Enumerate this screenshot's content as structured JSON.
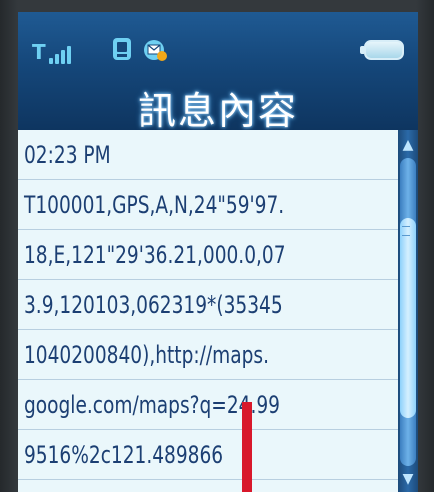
{
  "status_bar": {
    "signal_letter": "T",
    "signal_bars": [
      6,
      10,
      14,
      18
    ],
    "icons": [
      "phone-storage-icon",
      "new-message-icon"
    ],
    "battery": "battery-icon"
  },
  "header": {
    "title": "訊息內容"
  },
  "message": {
    "time": "02:23 PM",
    "lines": [
      "T100001,GPS,A,N,24\"59'97.",
      "18,E,121\"29'36.21,000.0,07",
      "3.9,120103,062319*(35345",
      "1040200840),http://maps.",
      "google.com/maps?q=24.99",
      "9516%2c121.489866"
    ]
  },
  "scrollbar": {
    "up_glyph": "▲",
    "down_glyph": "▼"
  },
  "colors": {
    "header_blue": "#15477a",
    "content_bg": "#eaf7fb",
    "text_blue": "#1c3f73",
    "marker_red": "#d8182b"
  }
}
